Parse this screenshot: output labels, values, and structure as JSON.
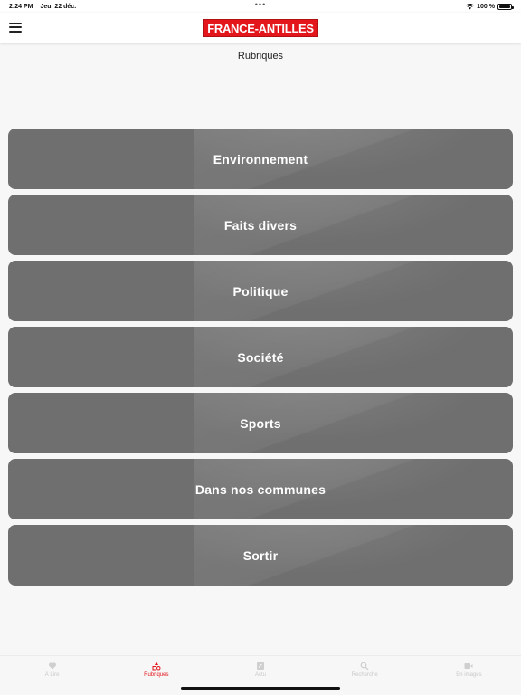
{
  "status_bar": {
    "time": "2:24 PM",
    "date": "Jeu. 22 déc.",
    "dots": "•••",
    "battery": "100 %"
  },
  "header": {
    "logo": "France-Antilles",
    "menu_icon": "hamburger-icon"
  },
  "page": {
    "title": "Rubriques"
  },
  "categories": [
    {
      "label": "Environnement"
    },
    {
      "label": "Faits divers"
    },
    {
      "label": "Politique"
    },
    {
      "label": "Société"
    },
    {
      "label": "Sports"
    },
    {
      "label": "Dans nos communes"
    },
    {
      "label": "Sortir"
    }
  ],
  "tab_bar": {
    "tabs": [
      {
        "label": "À Lire",
        "icon": "heart-icon"
      },
      {
        "label": "Rubriques",
        "icon": "shapes-icon",
        "active": true
      },
      {
        "label": "Actu",
        "icon": "news-icon"
      },
      {
        "label": "Recherche",
        "icon": "search-icon"
      },
      {
        "label": "En images",
        "icon": "video-icon"
      }
    ]
  },
  "colors": {
    "brand": "#e3161c",
    "card": "#6f6f6f",
    "background": "#f7f7f7"
  }
}
